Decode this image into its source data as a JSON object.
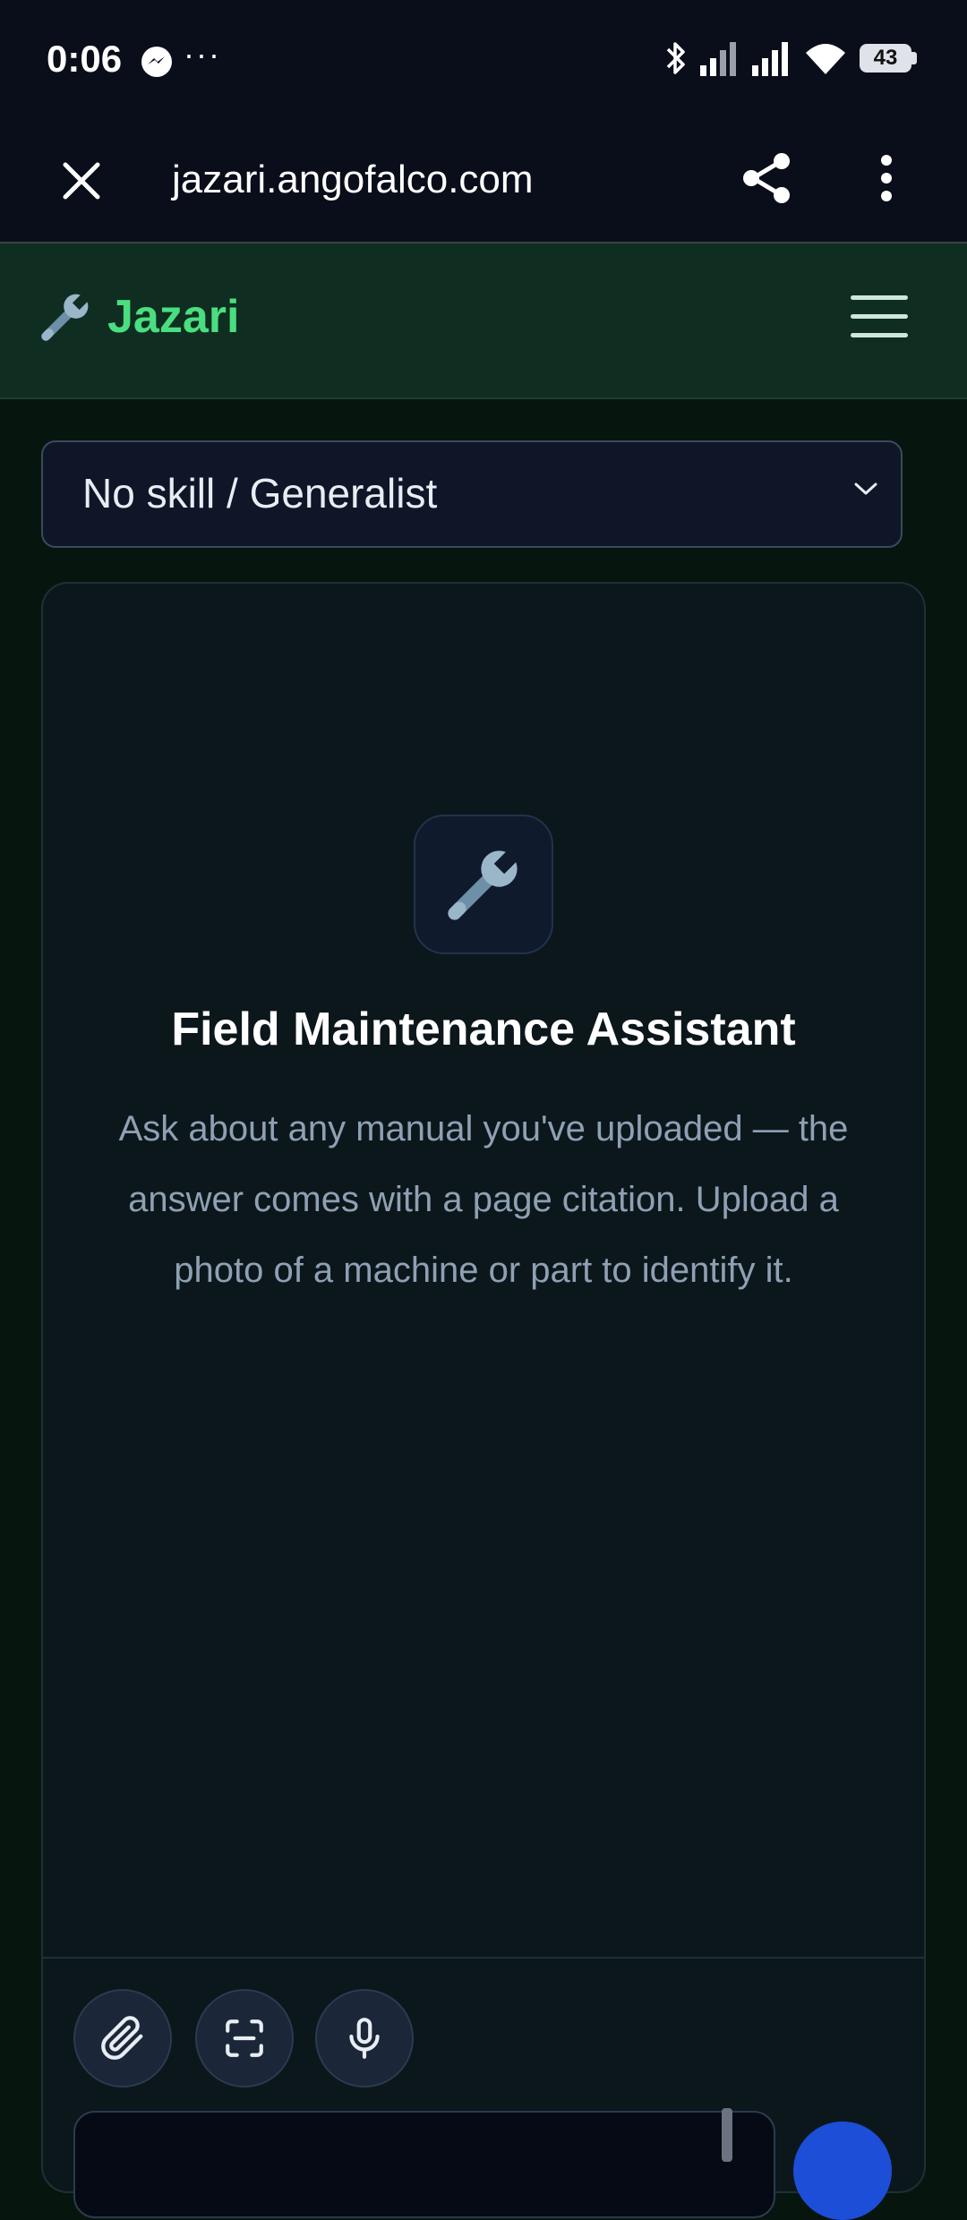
{
  "status_bar": {
    "time": "0:06",
    "overflow": "···",
    "battery": "43",
    "icons": [
      "messenger-icon",
      "bluetooth-icon",
      "signal-icon",
      "wifi-icon",
      "battery-icon"
    ]
  },
  "browser": {
    "url": "jazari.angofalco.com",
    "icons": [
      "close-icon",
      "share-icon",
      "more-vert-icon"
    ]
  },
  "header": {
    "brand_name": "Jazari",
    "brand_icon": "wrench-icon",
    "accent_color": "#4ade80"
  },
  "skill_select": {
    "value": "No skill / Generalist"
  },
  "empty_state": {
    "icon": "wrench-icon",
    "title": "Field Maintenance Assistant",
    "description": "Ask about any manual you've uploaded — the answer comes with a page citation. Upload a photo of a machine or part to identify it."
  },
  "composer": {
    "tools": [
      "attach-icon",
      "scan-icon",
      "microphone-icon"
    ],
    "input_value": "",
    "send_color": "#1d4ed8"
  }
}
